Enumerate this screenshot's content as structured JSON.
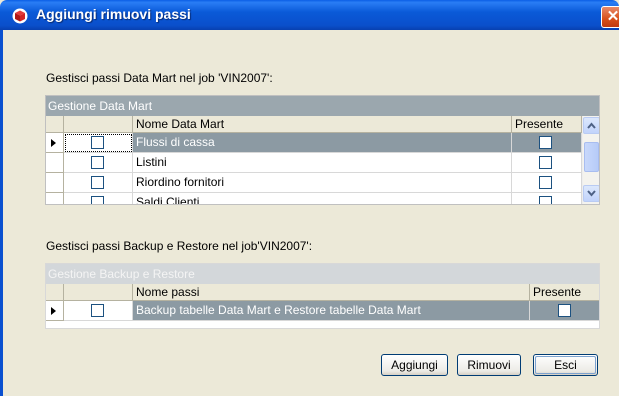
{
  "window": {
    "title": "Aggiungi rimuovi passi",
    "close_glyph": "✕",
    "icon": "app-cube-icon"
  },
  "section1": {
    "label": "Gestisci passi Data Mart nel job 'VIN2007':",
    "caption": "Gestione Data Mart",
    "columns": [
      "",
      "Nome Data Mart",
      "Presente"
    ],
    "rows": [
      {
        "name": "Flussi di cassa",
        "selected": true
      },
      {
        "name": "Listini",
        "selected": false
      },
      {
        "name": "Riordino fornitori",
        "selected": false
      },
      {
        "name": "Saldi Clienti",
        "selected": false
      }
    ]
  },
  "section2": {
    "label": "Gestisci passi Backup e Restore nel job'VIN2007':",
    "caption": "Gestione Backup e Restore",
    "columns": [
      "",
      "Nome passi",
      "Presente"
    ],
    "rows": [
      {
        "name": "Backup tabelle Data Mart e Restore tabelle Data Mart",
        "selected": true
      }
    ]
  },
  "buttons": {
    "add": "Aggiungi",
    "remove": "Rimuovi",
    "exit": "Esci"
  },
  "colors": {
    "titlebar": "#0a4fcb",
    "selection": "#8c9aa3",
    "caption": "#9ba7ae"
  }
}
